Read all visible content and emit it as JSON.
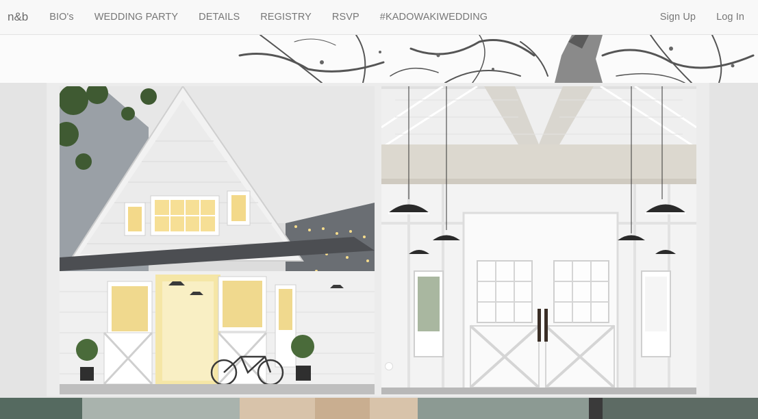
{
  "navbar": {
    "brand": "n&b",
    "items": [
      {
        "label": "BIO's"
      },
      {
        "label": "WEDDING PARTY"
      },
      {
        "label": "DETAILS"
      },
      {
        "label": "REGISTRY"
      },
      {
        "label": "RSVP"
      },
      {
        "label": "#KADOWAKIWEDDING"
      }
    ],
    "signup_label": "Sign Up",
    "login_label": "Log In"
  },
  "colors": {
    "navbar_bg": "#f8f8f8",
    "nav_text": "#777777",
    "page_bg": "#e6e6e6"
  },
  "gallery": {
    "slide_count": 1,
    "active_slide": 1
  }
}
